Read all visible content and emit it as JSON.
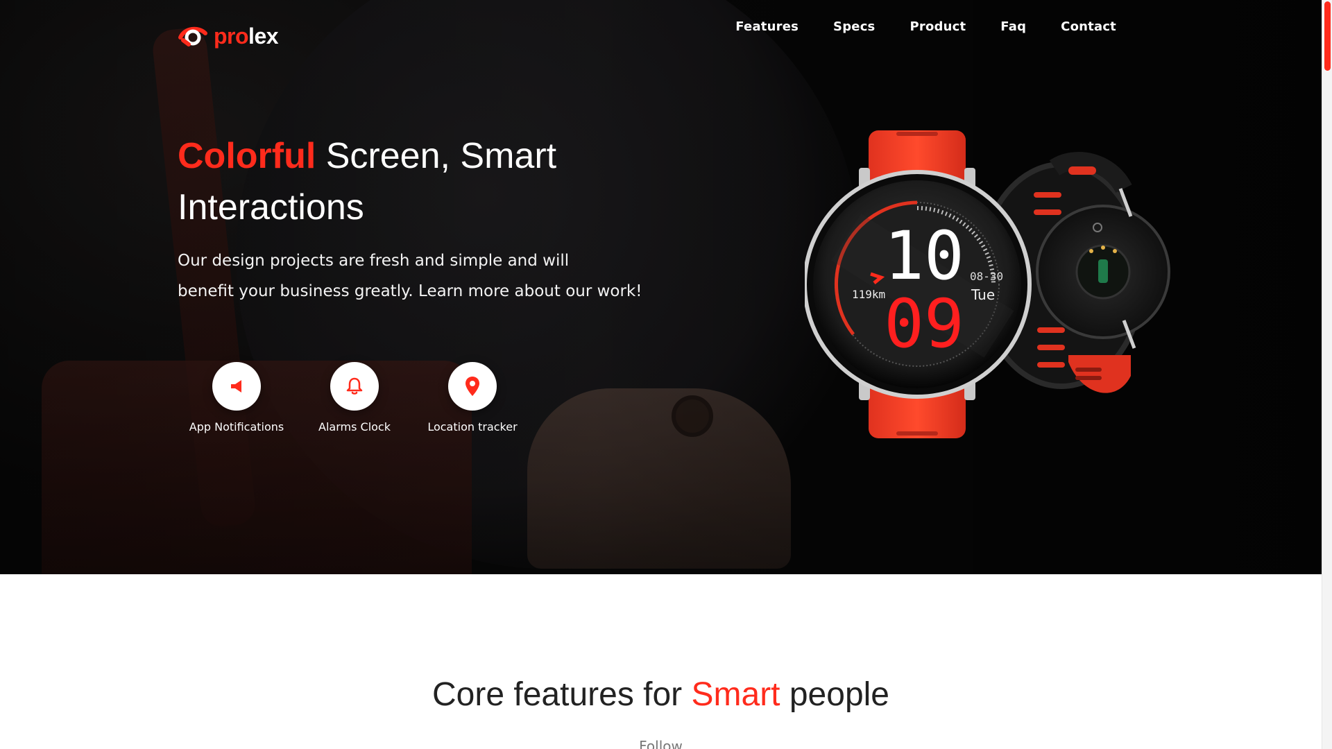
{
  "brand": {
    "part1": "pro",
    "part2": "lex",
    "accent_color": "#ff2b1c"
  },
  "nav": {
    "items": [
      {
        "label": "Features"
      },
      {
        "label": "Specs"
      },
      {
        "label": "Product"
      },
      {
        "label": "Faq"
      },
      {
        "label": "Contact"
      }
    ]
  },
  "hero": {
    "title_accent": "Colorful",
    "title_line1_rest": " Screen, Smart",
    "title_line2": "Interactions",
    "subtitle_line1": "Our design projects are fresh and simple and will",
    "subtitle_line2": "benefit your business greatly. Learn more about our work!",
    "features": [
      {
        "icon": "megaphone-icon",
        "label": "App Notifications"
      },
      {
        "icon": "bell-icon",
        "label": "Alarms Clock"
      },
      {
        "icon": "location-pin-icon",
        "label": "Location tracker"
      }
    ],
    "watch": {
      "hour": "10",
      "minute": "09",
      "date": "08-30",
      "day": "Tue",
      "distance": "119km"
    }
  },
  "core": {
    "title_before": "Core features for ",
    "title_accent": "Smart",
    "title_after": " people",
    "subtitle": "Follow"
  }
}
